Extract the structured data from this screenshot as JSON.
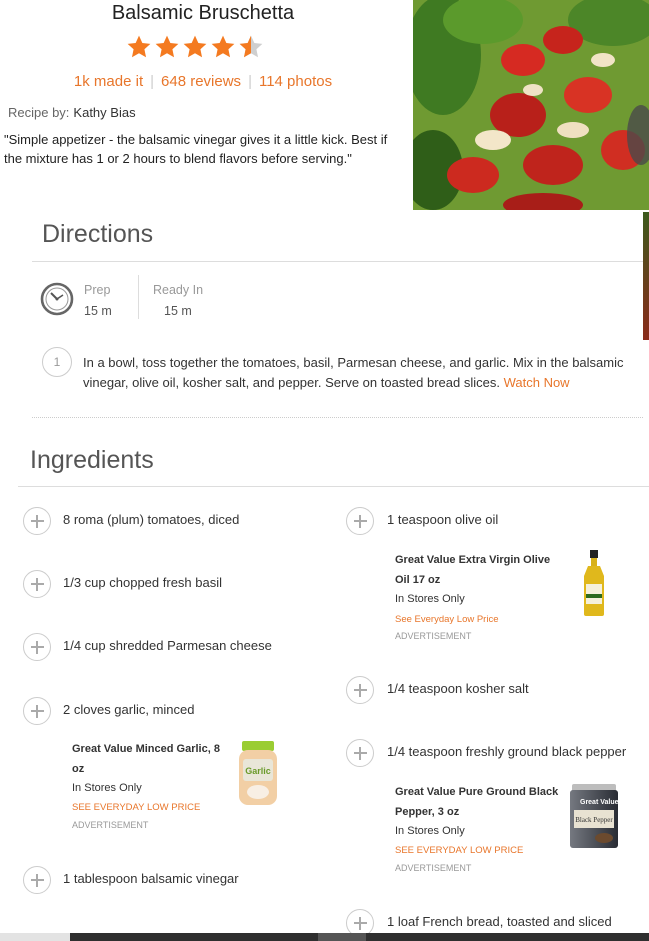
{
  "recipe": {
    "title": "Balsamic Bruschetta",
    "rating": 4.5,
    "made_it": "1k made it",
    "reviews": "648 reviews",
    "photos": "114 photos",
    "recipe_by_label": "Recipe by:",
    "author": "Kathy Bias",
    "description": "\"Simple appetizer - the balsamic vinegar gives it a little kick. Best if the mixture has 1 or 2 hours to blend flavors before serving.\""
  },
  "directions": {
    "heading": "Directions",
    "prep_label": "Prep",
    "prep_value": "15 m",
    "ready_label": "Ready In",
    "ready_value": "15 m",
    "steps": [
      {
        "number": "1",
        "text": "In a bowl, toss together the tomatoes, basil, Parmesan cheese, and garlic. Mix in the balsamic vinegar, olive oil, kosher salt, and pepper. Serve on toasted bread slices. ",
        "link": "Watch Now"
      }
    ]
  },
  "ingredients": {
    "heading": "Ingredients",
    "left": [
      "8 roma (plum) tomatoes, diced",
      "1/3 cup chopped fresh basil",
      "1/4 cup shredded Parmesan cheese",
      "2 cloves garlic, minced",
      "1 tablespoon balsamic vinegar"
    ],
    "right": [
      "1 teaspoon olive oil",
      "1/4 teaspoon kosher salt",
      "1/4 teaspoon freshly ground black pepper",
      "1 loaf French bread, toasted and sliced"
    ]
  },
  "ads": {
    "olive_oil": {
      "name_line1": "Great Value Extra Virgin Olive",
      "name_line2": "Oil 17 oz",
      "availability": "In Stores Only",
      "price": "See Everyday Low Price",
      "label": "ADVERTISEMENT"
    },
    "garlic": {
      "name_line1": "Great Value Minced Garlic, 8",
      "name_line2": "oz",
      "availability": "In Stores Only",
      "price": "SEE EVERYDAY LOW PRICE",
      "label": "ADVERTISEMENT",
      "jar_label": "Garlic"
    },
    "pepper": {
      "name_line1": "Great Value Pure Ground Black",
      "name_line2": "Pepper, 3 oz",
      "availability": "In Stores Only",
      "price": "SEE EVERYDAY LOW PRICE",
      "label": "ADVERTISEMENT",
      "box_brand": "Great Value",
      "box_label": "Black Pepper"
    }
  },
  "colors": {
    "accent": "#e8762b",
    "star": "#f47a20"
  },
  "icons": [
    "star-icon",
    "clock-icon",
    "plus-icon"
  ]
}
